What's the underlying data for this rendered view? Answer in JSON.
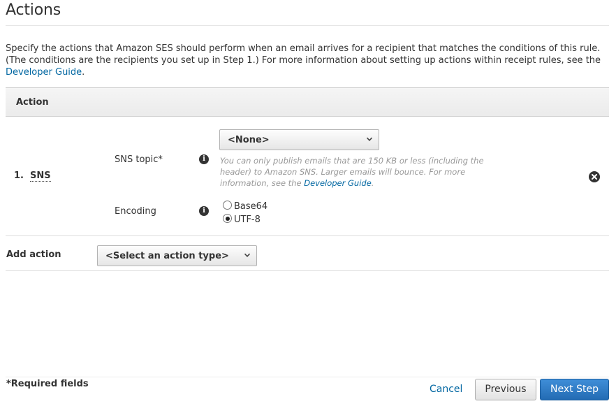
{
  "header": {
    "title": "Actions"
  },
  "description": {
    "text": "Specify the actions that Amazon SES should perform when an email arrives for a recipient that matches the conditions of this rule. (The conditions are the recipients you set up in Step 1.) For more information about setting up actions within receipt rules, see the ",
    "link": "Developer Guide",
    "suffix": "."
  },
  "table": {
    "header": "Action"
  },
  "action": {
    "number": "1.",
    "type": "SNS",
    "sns_topic": {
      "label": "SNS topic*",
      "selected": "<None>",
      "help_text": "You can only publish emails that are 150 KB or less (including the header) to Amazon SNS. Larger emails will bounce. For more information, see the ",
      "help_link": "Developer Guide",
      "help_suffix": "."
    },
    "encoding": {
      "label": "Encoding",
      "options": [
        "Base64",
        "UTF-8"
      ],
      "selected": "UTF-8"
    },
    "info_icon": "i"
  },
  "add_action": {
    "label": "Add action",
    "selected": "<Select an action type>"
  },
  "footer": {
    "required_note": "*Required fields",
    "cancel": "Cancel",
    "previous": "Previous",
    "next": "Next Step"
  },
  "icons": {
    "info": "info-icon",
    "remove": "remove-circle-icon",
    "dropdown": "chevron-down-icon"
  },
  "colors": {
    "link": "#0066a1",
    "primary_button": "#2d7bc6",
    "text": "#333333",
    "help_text": "#999999"
  }
}
